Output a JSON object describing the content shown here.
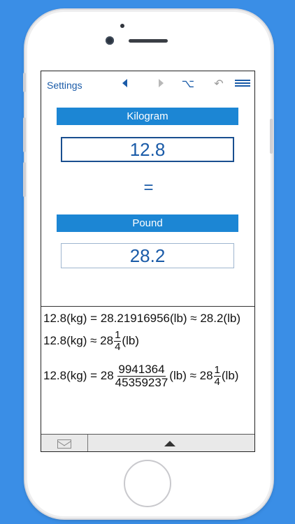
{
  "toolbar": {
    "settings_label": "Settings",
    "icons": [
      "back-triangle-icon",
      "forward-triangle-icon",
      "option-key-icon",
      "undo-icon",
      "menu-icon"
    ],
    "option_glyph": "⌥",
    "undo_glyph": "↶"
  },
  "converter": {
    "from_unit": "Kilogram",
    "from_value": "12.8",
    "equals": "=",
    "to_unit": "Pound",
    "to_value": "28.2"
  },
  "results": {
    "line1": "12.8(kg) = 28.21916956(lb) ≈ 28.2(lb)",
    "line2": {
      "prefix": "12.8(kg) ≈ 28",
      "num": "1",
      "den": "4",
      "suffix": "(lb)"
    },
    "line3": {
      "prefix": "12.8(kg) = 28",
      "num": "9941364",
      "den": "45359237",
      "middle": "(lb) ≈ 28",
      "num2": "1",
      "den2": "4",
      "suffix": "(lb)"
    }
  },
  "bottombar": {
    "icons": [
      "mail-icon",
      "expand-up-icon"
    ]
  },
  "colors": {
    "background": "#3a8ee6",
    "accent": "#1c86d4",
    "text_blue": "#1a5ba8"
  }
}
